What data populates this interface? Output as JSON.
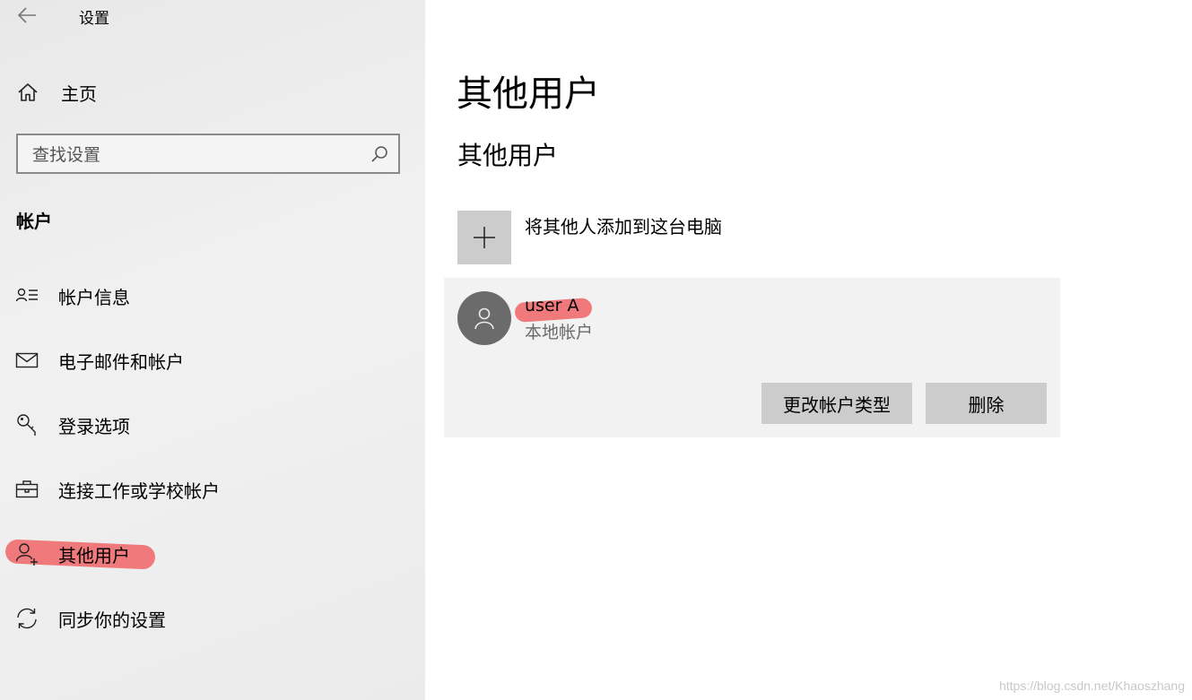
{
  "window": {
    "title": "设置"
  },
  "sidebar": {
    "home_label": "主页",
    "search": {
      "placeholder": "查找设置",
      "value": ""
    },
    "section_title": "帐户",
    "items": [
      {
        "label": "帐户信息",
        "icon": "account-info-icon"
      },
      {
        "label": "电子邮件和帐户",
        "icon": "mail-icon"
      },
      {
        "label": "登录选项",
        "icon": "key-icon"
      },
      {
        "label": "连接工作或学校帐户",
        "icon": "briefcase-icon"
      },
      {
        "label": "其他用户",
        "icon": "add-person-icon"
      },
      {
        "label": "同步你的设置",
        "icon": "sync-icon"
      }
    ]
  },
  "main": {
    "page_title": "其他用户",
    "section_title": "其他用户",
    "add_label": "将其他人添加到这台电脑",
    "user": {
      "name": "user A",
      "type": "本地帐户",
      "change_type_label": "更改帐户类型",
      "delete_label": "删除"
    }
  },
  "watermark": "https://blog.csdn.net/Khaoszhang",
  "colors": {
    "sidebar_bg": "#ebebeb",
    "card_bg": "#f2f2f2",
    "button_bg": "#cccccc",
    "avatar_bg": "#6b6b6b",
    "highlight": "#ef6b6f"
  }
}
